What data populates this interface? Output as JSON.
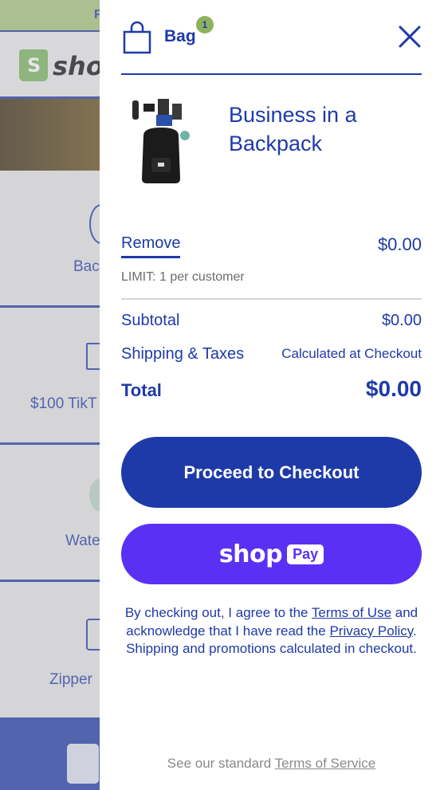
{
  "background": {
    "topbar_text": "F",
    "logo_text": "shop",
    "categories": [
      {
        "label": "Bac"
      },
      {
        "label": "$100 TikT"
      },
      {
        "label": "Wate"
      },
      {
        "label": "Zipper"
      }
    ]
  },
  "bag": {
    "title": "Bag",
    "count": "1",
    "icons": {
      "bag": "shopping-bag-icon",
      "close": "close-icon"
    }
  },
  "item": {
    "title": "Business in a Backpack",
    "image": "backpack-product-image",
    "remove_label": "Remove",
    "price": "$0.00",
    "limit": "LIMIT: 1 per customer"
  },
  "summary": {
    "subtotal_label": "Subtotal",
    "subtotal_value": "$0.00",
    "shipping_label": "Shipping & Taxes",
    "shipping_value": "Calculated at Checkout",
    "total_label": "Total",
    "total_value": "$0.00"
  },
  "actions": {
    "checkout_label": "Proceed to Checkout",
    "shoppay_shop": "shop",
    "shoppay_pay": "Pay"
  },
  "legal": {
    "part1": "By checking out, I agree to the ",
    "terms_of_use": "Terms of Use",
    "part2": " and acknowledge that I have read the ",
    "privacy_policy": "Privacy Policy",
    "part3": ". Shipping and promotions calculated in checkout."
  },
  "footnote": {
    "prefix": "See our standard ",
    "link": "Terms of Service"
  },
  "colors": {
    "brand_blue": "#1e3aa8",
    "shoppay_purple": "#5a31f4",
    "badge_green": "#8fb15f"
  }
}
